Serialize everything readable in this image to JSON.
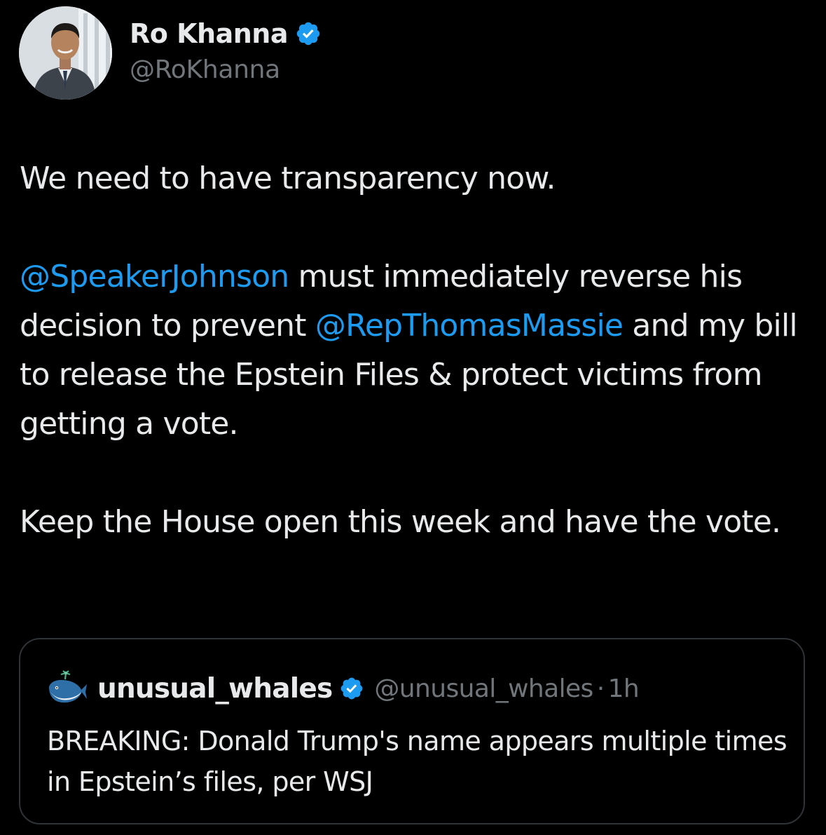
{
  "author": {
    "name": "Ro Khanna",
    "handle": "@RoKhanna",
    "verified": true,
    "avatar_icon": "profile-photo-icon"
  },
  "tweet": {
    "line1": "We need to have transparency now.",
    "mention1": "@SpeakerJohnson",
    "text2a": " must immediately reverse his decision to prevent ",
    "mention2": "@RepThomasMassie",
    "text2b": " and my bill to release the Epstein Files & protect victims from getting a vote.",
    "line3": "Keep the House open this week and have the vote."
  },
  "quote": {
    "name": "unusual_whales",
    "handle": "@unusual_whales",
    "separator": "·",
    "time": "1h",
    "verified": true,
    "avatar_icon": "whale-icon",
    "text": "BREAKING: Donald Trump's name appears multiple times in Epstein’s files, per WSJ"
  },
  "colors": {
    "background": "#000000",
    "text": "#e7e9ea",
    "secondary": "#71767b",
    "accent": "#1d9bf0",
    "border": "#2f3336"
  }
}
